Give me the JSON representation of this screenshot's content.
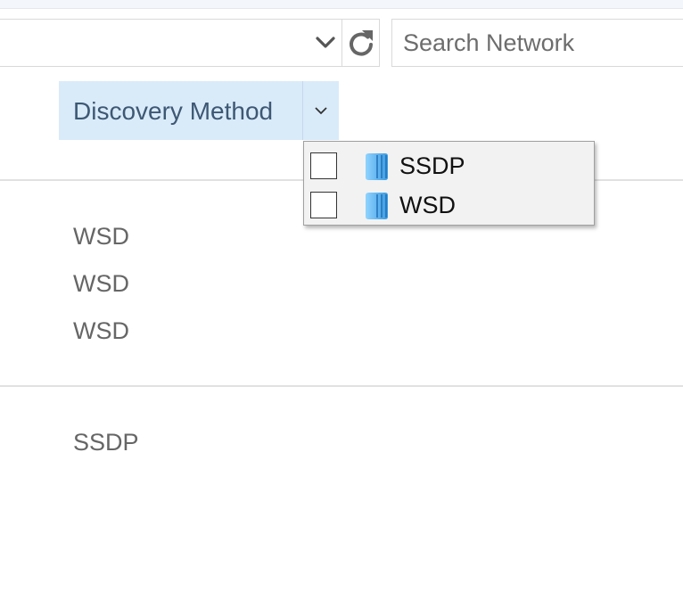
{
  "search": {
    "placeholder": "Search Network"
  },
  "column_header": {
    "label": "Discovery Method"
  },
  "filter_popup": {
    "options": [
      {
        "label": "SSDP",
        "checked": false,
        "icon": "network-device-icon"
      },
      {
        "label": "WSD",
        "checked": false,
        "icon": "network-device-icon"
      }
    ]
  },
  "groups": [
    {
      "rows": [
        "WSD",
        "WSD",
        "WSD"
      ]
    },
    {
      "rows": [
        "SSDP"
      ]
    }
  ],
  "colors": {
    "header_background": "#d9ebf9",
    "header_text": "#3e5874",
    "icon_blue": "#3a9be0"
  }
}
